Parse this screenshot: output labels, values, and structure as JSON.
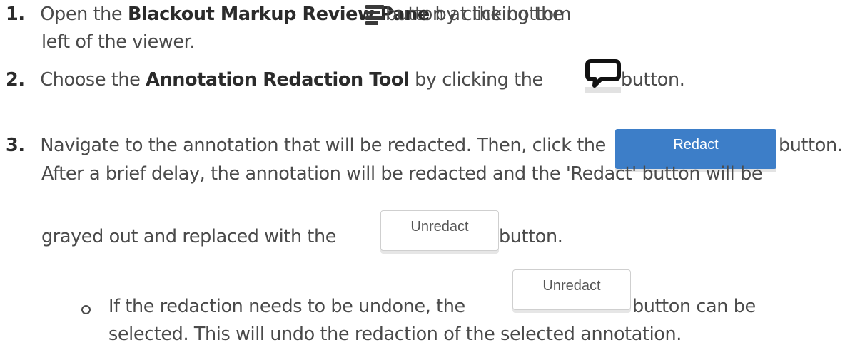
{
  "steps": [
    {
      "number": "1.",
      "pre": "Open the ",
      "bold": "Blackout Markup Review Pane",
      "mid": " by clicking the ",
      "post": " button at the bottom",
      "line2": "left of the viewer.",
      "icon": "review-pane-icon"
    },
    {
      "number": "2.",
      "pre": "Choose the ",
      "bold": "Annotation Redaction Tool",
      "mid": " by clicking the ",
      "post": " button.",
      "icon": "speech-bubble-icon"
    },
    {
      "number": "3.",
      "pre": "Navigate to the annotation that will be redacted. Then, click the ",
      "post": " button.",
      "line2": "After a brief delay, the annotation will be redacted and the 'Redact' button will be",
      "line3_pre": "grayed out and replaced with the ",
      "line3_post": " button.",
      "sub": {
        "pre": "If the redaction needs to be undone, the ",
        "post": " button can be",
        "line2": "selected. This will undo the redaction of the selected annotation."
      }
    }
  ],
  "buttons": {
    "redact": "Redact",
    "unredact": "Unredact"
  },
  "colors": {
    "redact_bg": "#3d7ec8",
    "text": "#4a4a4a"
  }
}
